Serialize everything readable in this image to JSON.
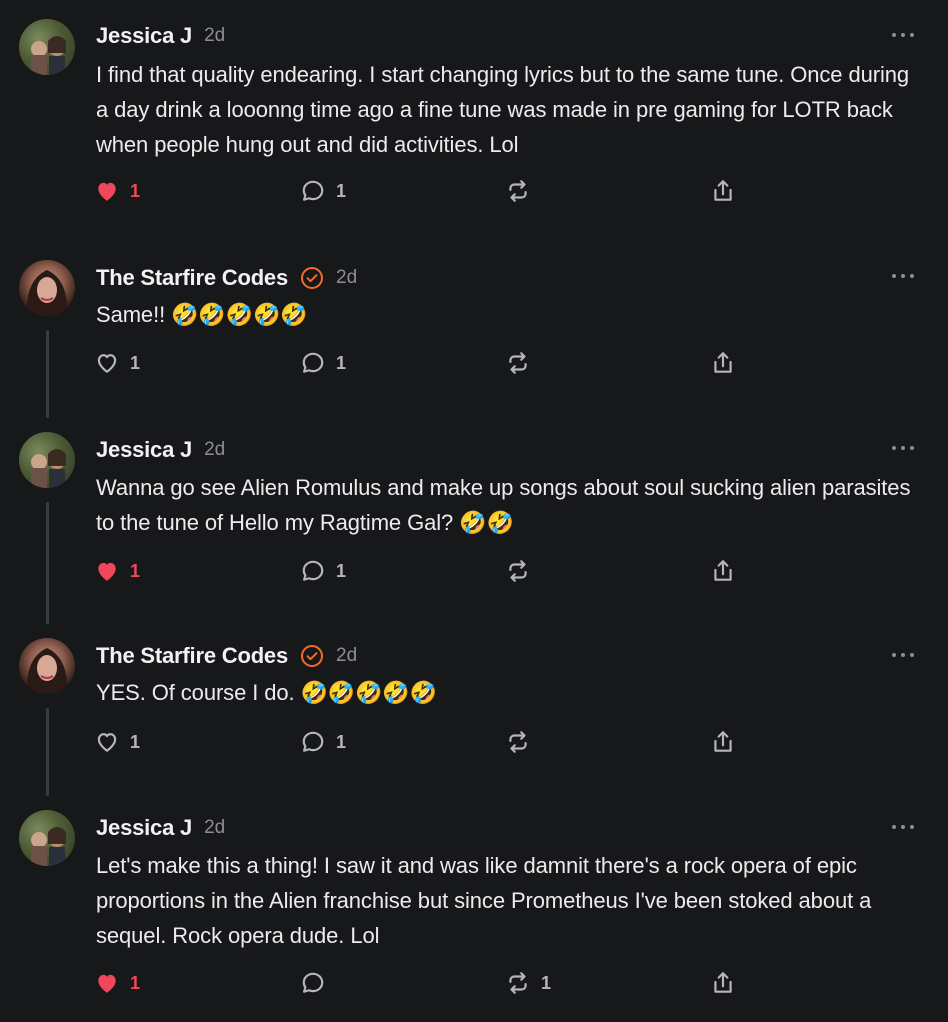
{
  "colors": {
    "background": "#17181a",
    "liked": "#f0475a",
    "verified": "#f26b2a",
    "muted": "#8d8e93"
  },
  "icons": {
    "like": "heart-icon",
    "reply": "speech-bubble-icon",
    "restack": "restack-arrows-icon",
    "share": "share-upload-icon",
    "more": "ellipsis-icon",
    "verified": "verified-check-badge-icon"
  },
  "comments": [
    {
      "author": "Jessica J",
      "age": "2d",
      "verified": false,
      "text": "I find that quality endearing. I start changing lyrics but to the same tune. Once during a day drink a looonng time ago a fine tune was made in pre gaming for LOTR back when people hung out and did activities. Lol",
      "likes": "1",
      "liked": true,
      "replies": "1",
      "restacks": ""
    },
    {
      "author": "The Starfire Codes",
      "age": "2d",
      "verified": true,
      "text": "Same!! 🤣🤣🤣🤣🤣",
      "likes": "1",
      "liked": false,
      "replies": "1",
      "restacks": ""
    },
    {
      "author": "Jessica J",
      "age": "2d",
      "verified": false,
      "text": "Wanna go see Alien Romulus and make up songs about soul sucking alien parasites to the tune of Hello my Ragtime Gal? 🤣🤣",
      "likes": "1",
      "liked": true,
      "replies": "1",
      "restacks": ""
    },
    {
      "author": "The Starfire Codes",
      "age": "2d",
      "verified": true,
      "text": "YES. Of course I do. 🤣🤣🤣🤣🤣",
      "likes": "1",
      "liked": false,
      "replies": "1",
      "restacks": ""
    },
    {
      "author": "Jessica J",
      "age": "2d",
      "verified": false,
      "text": "Let's make this a thing! I saw it and was like damnit there's a rock opera of epic proportions in the Alien franchise but since Prometheus I've been stoked about a sequel. Rock opera dude. Lol",
      "likes": "1",
      "liked": true,
      "replies": "",
      "restacks": "1"
    }
  ]
}
